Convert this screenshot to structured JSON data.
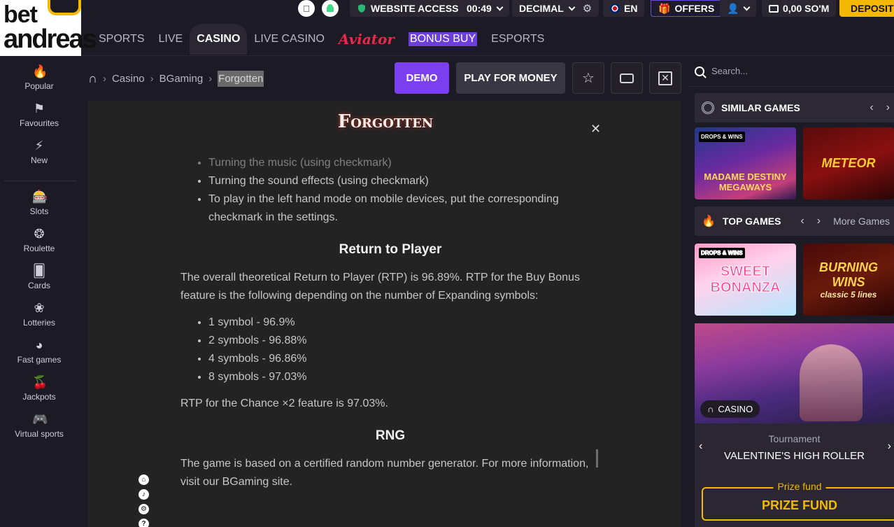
{
  "logo": {
    "line1": "bet",
    "line2": "andreas"
  },
  "topbar": {
    "apple_icon": "apple-icon",
    "android_icon": "android-icon",
    "website_access": "WEBSITE ACCESS",
    "time": "00:49",
    "odds_format": "DECIMAL",
    "language": "EN",
    "offers": "OFFERS",
    "balance": "0,00 SO'M",
    "deposit": "DEPOSIT"
  },
  "nav": {
    "items": [
      {
        "label": "SPORTS"
      },
      {
        "label": "LIVE"
      },
      {
        "label": "CASINO"
      },
      {
        "label": "LIVE CASINO"
      },
      {
        "label": "Aviator"
      },
      {
        "label": "BONUS BUY"
      },
      {
        "label": "ESPORTS"
      }
    ]
  },
  "sidebar": {
    "items": [
      {
        "label": "Popular",
        "icon": "fire-icon"
      },
      {
        "label": "Favourites",
        "icon": "bookmark-icon"
      },
      {
        "label": "New",
        "icon": "lightning-icon"
      },
      {
        "label": "Slots",
        "icon": "slot-machine-icon"
      },
      {
        "label": "Roulette",
        "icon": "roulette-icon"
      },
      {
        "label": "Cards",
        "icon": "cards-icon"
      },
      {
        "label": "Lotteries",
        "icon": "lottery-icon"
      },
      {
        "label": "Fast games",
        "icon": "speedometer-icon"
      },
      {
        "label": "Jackpots",
        "icon": "cherries-icon"
      },
      {
        "label": "Virtual sports",
        "icon": "gamepad-icon"
      }
    ]
  },
  "breadcrumb": {
    "casino": "Casino",
    "provider": "BGaming",
    "game": "Forgotten"
  },
  "actions": {
    "demo": "DEMO",
    "play_for_money": "PLAY FOR MONEY"
  },
  "game": {
    "logo": "Forgotten",
    "bullets_top": [
      "Turning the music (using checkmark)",
      "Turning the sound effects (using checkmark)",
      "To play in the left hand mode on mobile devices, put the corresponding checkmark in the settings."
    ],
    "rtp_heading": "Return to Player",
    "rtp_paragraph": "The overall theoretical Return to Player (RTP) is 96.89%. RTP for the Buy Bonus feature is the following depending on the number of Expanding symbols:",
    "rtp_list": [
      "1 symbol - 96.9%",
      "2 symbols - 96.88%",
      "4 symbols - 96.86%",
      "8 symbols - 97.03%"
    ],
    "rtp_chance": "RTP for the Chance ×2 feature is 97.03%.",
    "rng_heading": "RNG",
    "rng_paragraph": "The game is based on a certified random number generator. For more information, visit our BGaming site."
  },
  "right": {
    "search_placeholder": "Search...",
    "similar_games": "SIMILAR GAMES",
    "top_games": "TOP GAMES",
    "more_games": "More Games",
    "tiles": {
      "madame": "MADAME DESTINY MEGAWAYS",
      "meteor": "METEOR",
      "sweet": "SWEET BONANZA",
      "burning": "BURNING WINS",
      "burning_sub": "classic 5 lines",
      "drops": "DROPS & WINS"
    },
    "casino_tag": "CASINO",
    "tournament_label": "Tournament",
    "tournament_name": "VALENTINE'S HIGH ROLLER",
    "prize_label": "Prize fund",
    "prize_value": "PRIZE FUND"
  }
}
